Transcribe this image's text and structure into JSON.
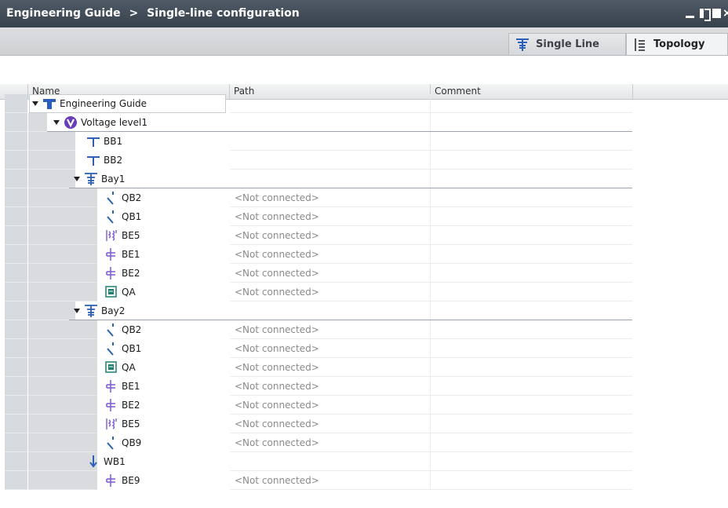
{
  "window": {
    "title": "Engineering Guide",
    "separator": ">",
    "subtitle": "Single-line configuration",
    "close_glyph": "×"
  },
  "tabs": [
    {
      "label": "Single Line",
      "icon": "single-line-icon"
    },
    {
      "label": "Topology",
      "icon": "topology-icon"
    }
  ],
  "columns": {
    "name": "Name",
    "path": "Path",
    "comment": "Comment"
  },
  "rows": [
    {
      "name": "Engineering Guide",
      "icon": "station-icon",
      "expanded": true,
      "path": ""
    },
    {
      "name": "Voltage level1",
      "icon": "voltage-level-icon",
      "expanded": true,
      "path": ""
    },
    {
      "name": "BB1",
      "icon": "busbar-icon",
      "path": ""
    },
    {
      "name": "BB2",
      "icon": "busbar-icon",
      "path": ""
    },
    {
      "name": "Bay1",
      "icon": "bay-icon",
      "expanded": true,
      "path": ""
    },
    {
      "name": "QB2",
      "icon": "disconnector-icon",
      "path": "<Not connected>"
    },
    {
      "name": "QB1",
      "icon": "disconnector-icon",
      "path": "<Not connected>"
    },
    {
      "name": "BE5",
      "icon": "voltage-transformer-icon",
      "path": "<Not connected>"
    },
    {
      "name": "BE1",
      "icon": "current-transformer-icon",
      "path": "<Not connected>"
    },
    {
      "name": "BE2",
      "icon": "current-transformer-icon",
      "path": "<Not connected>"
    },
    {
      "name": "QA",
      "icon": "circuit-breaker-icon",
      "path": "<Not connected>"
    },
    {
      "name": "Bay2",
      "icon": "bay-icon",
      "expanded": true,
      "path": ""
    },
    {
      "name": "QB2",
      "icon": "disconnector-icon",
      "path": "<Not connected>"
    },
    {
      "name": "QB1",
      "icon": "disconnector-icon",
      "path": "<Not connected>"
    },
    {
      "name": "QA",
      "icon": "circuit-breaker-icon",
      "path": "<Not connected>"
    },
    {
      "name": "BE1",
      "icon": "current-transformer-icon",
      "path": "<Not connected>"
    },
    {
      "name": "BE2",
      "icon": "current-transformer-icon",
      "path": "<Not connected>"
    },
    {
      "name": "BE5",
      "icon": "voltage-transformer-icon",
      "path": "<Not connected>"
    },
    {
      "name": "QB9",
      "icon": "disconnector-icon",
      "path": "<Not connected>"
    },
    {
      "name": "WB1",
      "icon": "ground-icon",
      "path": ""
    },
    {
      "name": "BE9",
      "icon": "current-transformer-icon",
      "path": "<Not connected>"
    }
  ],
  "colors": {
    "titlebar": "#37414c",
    "voltage_level": "#6a3fb5",
    "icon_blue": "#2c5fb8",
    "breaker": "#1e7f73",
    "path_text": "#8a8a8a"
  }
}
